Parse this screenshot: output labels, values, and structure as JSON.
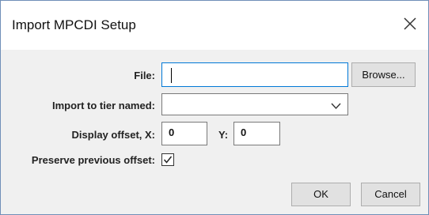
{
  "dialog": {
    "title": "Import MPCDI Setup",
    "close_icon": "close-icon"
  },
  "form": {
    "file_label": "File:",
    "file_value": "",
    "browse_label": "Browse...",
    "tier_label": "Import to tier named:",
    "tier_value": "",
    "tier_icon": "chevron-down-icon",
    "offset_label": "Display offset, X:",
    "offset_x": "0",
    "offset_y_label": "Y:",
    "offset_y": "0",
    "preserve_label": "Preserve previous offset:",
    "preserve_checked": true,
    "check_icon": "check-icon"
  },
  "buttons": {
    "ok": "OK",
    "cancel": "Cancel"
  },
  "colors": {
    "focus_border": "#0078d7",
    "dialog_border": "#6f8fb8",
    "background": "#f0f0f0"
  }
}
